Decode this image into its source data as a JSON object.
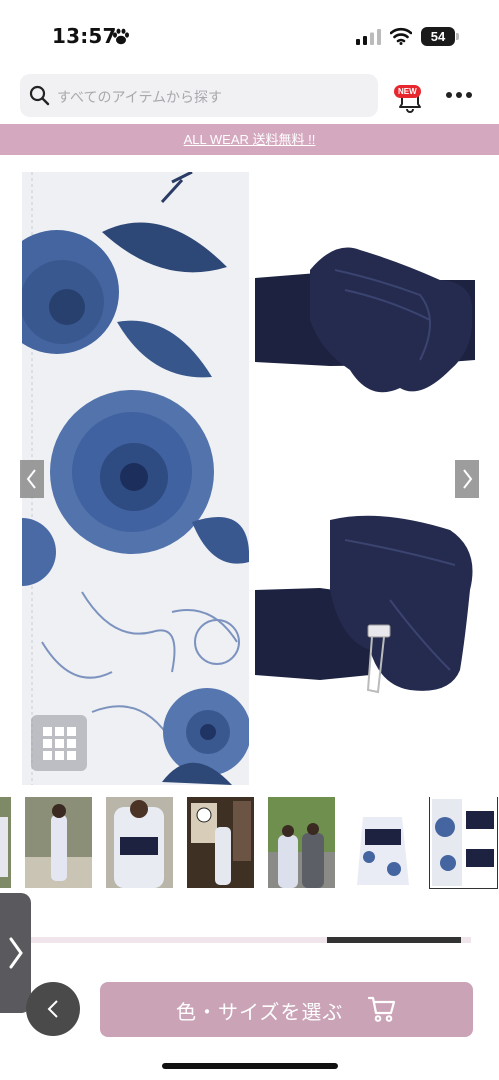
{
  "status_bar": {
    "time": "13:57",
    "battery": "54"
  },
  "header": {
    "search_placeholder": "すべてのアイテムから探す",
    "new_badge": "NEW"
  },
  "banner": {
    "text": "ALL WEAR 送料無料 !!"
  },
  "gallery": {
    "colors": {
      "fabric_background": "#eef0f3",
      "flower_blue": "#2f4f86",
      "obi_navy": "#1c2240"
    }
  },
  "bottom_bar": {
    "cta_label": "色・サイズを選ぶ",
    "accent_color": "#caa3b6"
  }
}
